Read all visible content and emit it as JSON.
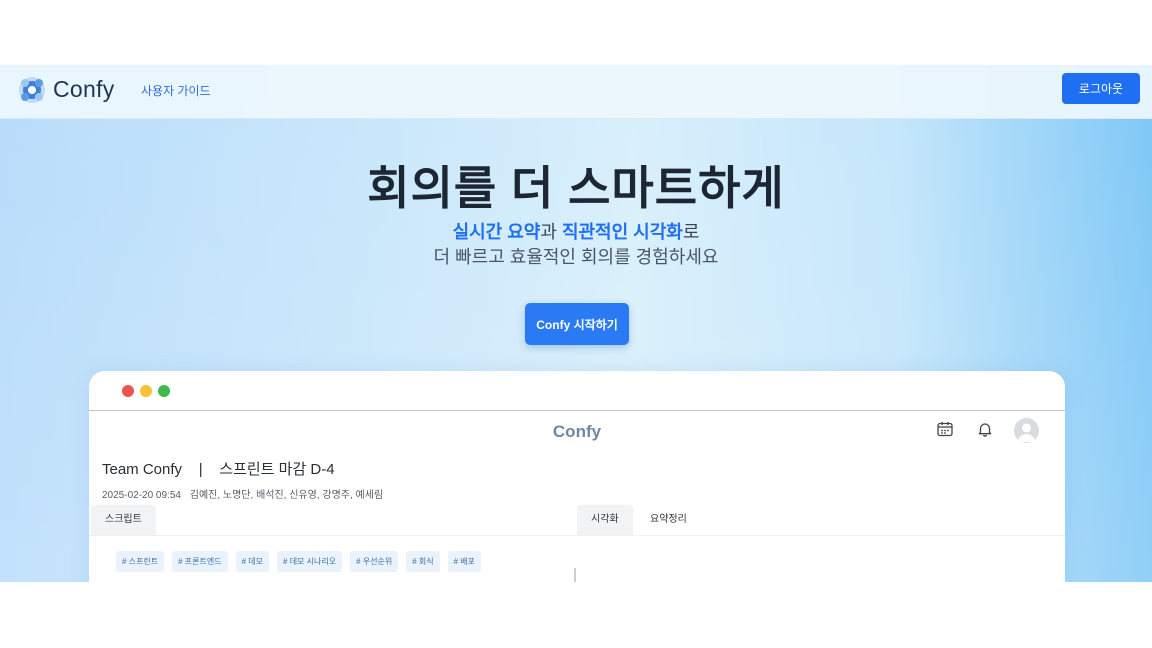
{
  "nav": {
    "brand": "Confy",
    "guide_link": "사용자 가이드",
    "logout_label": "로그아웃"
  },
  "hero": {
    "title": "회의를 더 스마트하게",
    "sub_highlight_1": "실시간 요약",
    "sub_connector_1": "과 ",
    "sub_highlight_2": "직관적인 시각화",
    "sub_connector_2": "로",
    "sub_line_2": "더 빠르고 효율적인 회의를 경험하세요",
    "cta_label": "Confy 시작하기"
  },
  "preview": {
    "app_brand": "Confy",
    "meeting_title": "Team Confy    |    스프린트 마감 D-4",
    "datetime": "2025-02-20 09:54",
    "participants": "김예진, 노명단, 배석진, 신유영, 강명주, 예세림",
    "tabs": {
      "script": "스크립트",
      "visual": "시각화",
      "summary": "요약정리"
    },
    "tags": [
      "# 스프린트",
      "# 프론트엔드",
      "# 데모",
      "# 데모 시나리오",
      "# 우선순위",
      "# 회식",
      "# 배포"
    ]
  },
  "icons": [
    "logo-icon",
    "calendar-icon",
    "bell-icon",
    "avatar-icon"
  ],
  "colors": {
    "accent": "#1f6ff2",
    "cta": "#2a7bf3",
    "title": "#1d2633",
    "tag_bg": "#eaf2fb",
    "tag_text": "#3b6fa8"
  }
}
